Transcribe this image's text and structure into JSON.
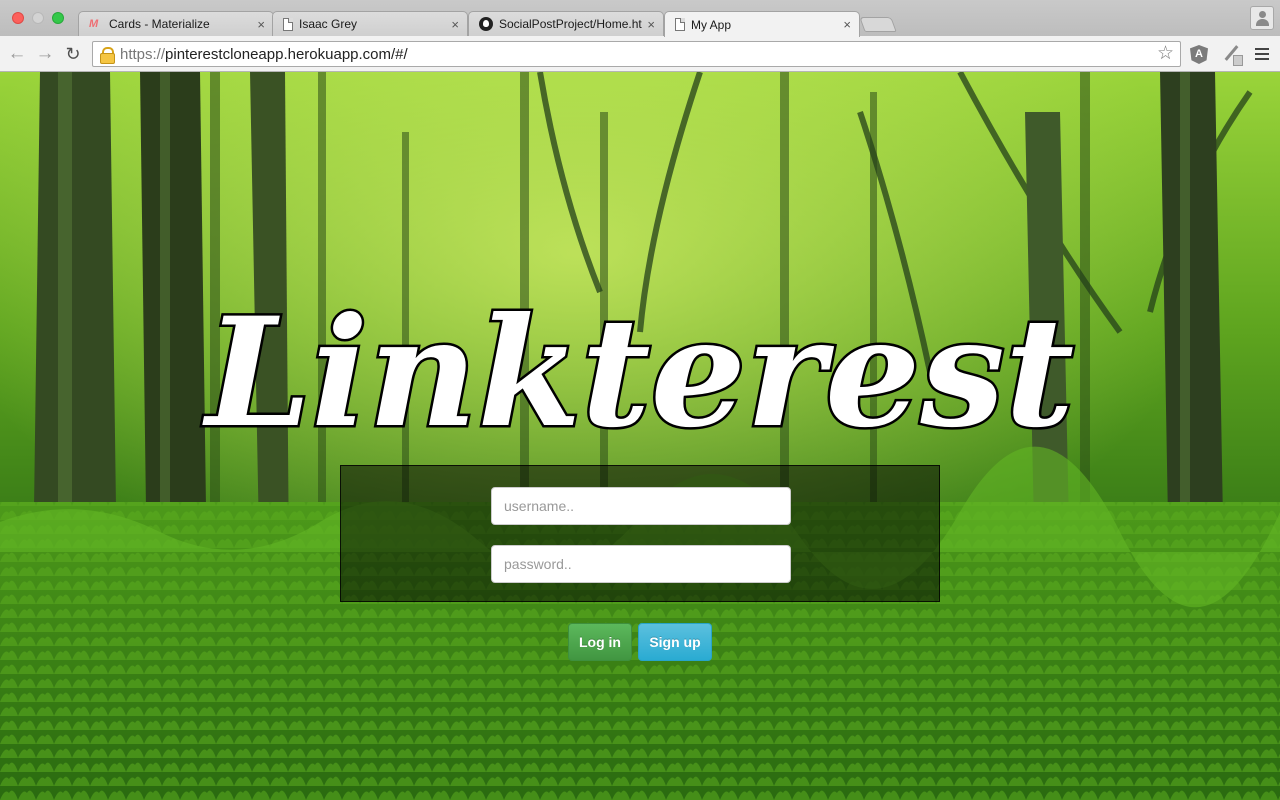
{
  "browser": {
    "tabs": [
      {
        "title": "Cards - Materialize",
        "close": "×",
        "favicon": "materialize-icon",
        "active": false
      },
      {
        "title": "Isaac Grey",
        "close": "×",
        "favicon": "document-icon",
        "active": false
      },
      {
        "title": "SocialPostProject/Home.ht",
        "close": "×",
        "favicon": "github-icon",
        "active": false
      },
      {
        "title": "My App",
        "close": "×",
        "favicon": "document-icon",
        "active": true
      }
    ],
    "address": {
      "scheme": "https://",
      "host_path": "pinterestcloneapp.herokuapp.com/#/"
    },
    "extension_label": "A"
  },
  "page": {
    "logo_text": "Linkterest",
    "username_placeholder": "username..",
    "password_placeholder": "password..",
    "login_label": "Log in",
    "signup_label": "Sign up",
    "colors": {
      "login_button": "#5cb85c",
      "signup_button": "#5bc0de",
      "logo_fill": "#ffffff",
      "logo_outline": "#000000"
    }
  }
}
